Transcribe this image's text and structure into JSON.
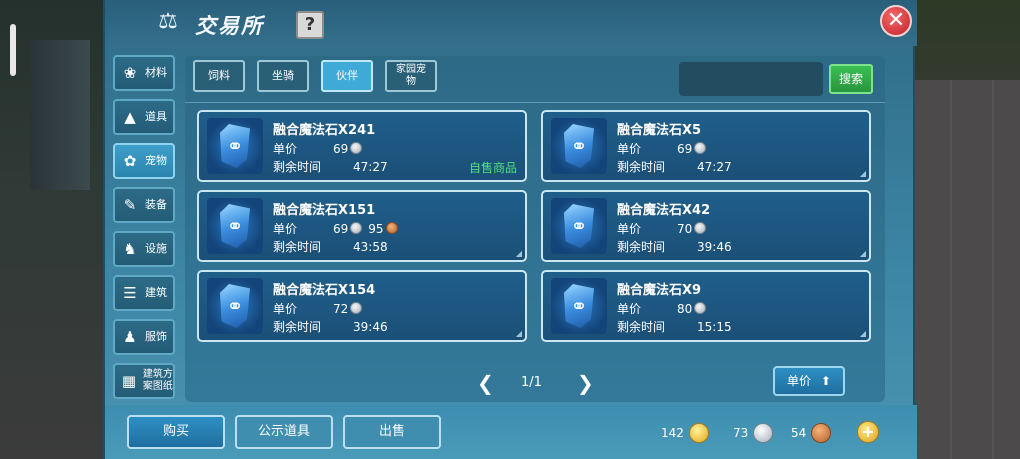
{
  "window": {
    "title": "交易所",
    "help_label": "?",
    "close_label": "✕"
  },
  "categories": [
    {
      "label": "材料",
      "icon": "materials-icon",
      "glyph": "❀",
      "active": false
    },
    {
      "label": "道具",
      "icon": "item-icon",
      "glyph": "▲",
      "active": false
    },
    {
      "label": "宠物",
      "icon": "paw-icon",
      "glyph": "✿",
      "active": true
    },
    {
      "label": "装备",
      "icon": "equipment-icon",
      "glyph": "✎",
      "active": false
    },
    {
      "label": "设施",
      "icon": "facility-icon",
      "glyph": "♞",
      "active": false
    },
    {
      "label": "建筑",
      "icon": "building-icon",
      "glyph": "☰",
      "active": false
    },
    {
      "label": "服饰",
      "icon": "clothing-icon",
      "glyph": "♟",
      "active": false
    },
    {
      "label": "建筑方案图纸",
      "icon": "blueprint-icon",
      "glyph": "▦",
      "active": false
    }
  ],
  "tabs": [
    {
      "label": "饲料",
      "active": false
    },
    {
      "label": "坐骑",
      "active": false
    },
    {
      "label": "伙伴",
      "active": true
    },
    {
      "label": "家园宠物",
      "active": false
    }
  ],
  "search": {
    "value": "",
    "button_label": "搜索"
  },
  "listing_labels": {
    "price": "单价",
    "time": "剩余时间"
  },
  "listings": [
    {
      "name": "融合魔法石X241",
      "price_silver": "69",
      "price_bronze": "",
      "time": "47:27",
      "tag": "自售商品"
    },
    {
      "name": "融合魔法石X5",
      "price_silver": "69",
      "price_bronze": "",
      "time": "47:27",
      "tag": ""
    },
    {
      "name": "融合魔法石X151",
      "price_silver": "69",
      "price_bronze": "95",
      "time": "43:58",
      "tag": ""
    },
    {
      "name": "融合魔法石X42",
      "price_silver": "70",
      "price_bronze": "",
      "time": "39:46",
      "tag": ""
    },
    {
      "name": "融合魔法石X154",
      "price_silver": "72",
      "price_bronze": "",
      "time": "39:46",
      "tag": ""
    },
    {
      "name": "融合魔法石X9",
      "price_silver": "80",
      "price_bronze": "",
      "time": "15:15",
      "tag": ""
    }
  ],
  "pager": {
    "text": "1/1",
    "prev": "❮",
    "next": "❯"
  },
  "sort": {
    "label": "单价"
  },
  "bottom": {
    "buy_label": "购买",
    "show_label": "公示道具",
    "sell_label": "出售"
  },
  "currency": {
    "gold": "142",
    "silver": "73",
    "bronze": "54",
    "add_label": "+"
  },
  "colors": {
    "accent": "#3fa9d8",
    "self_tag": "#4fe37a",
    "close": "#c4202a",
    "search_btn": "#27963c"
  }
}
